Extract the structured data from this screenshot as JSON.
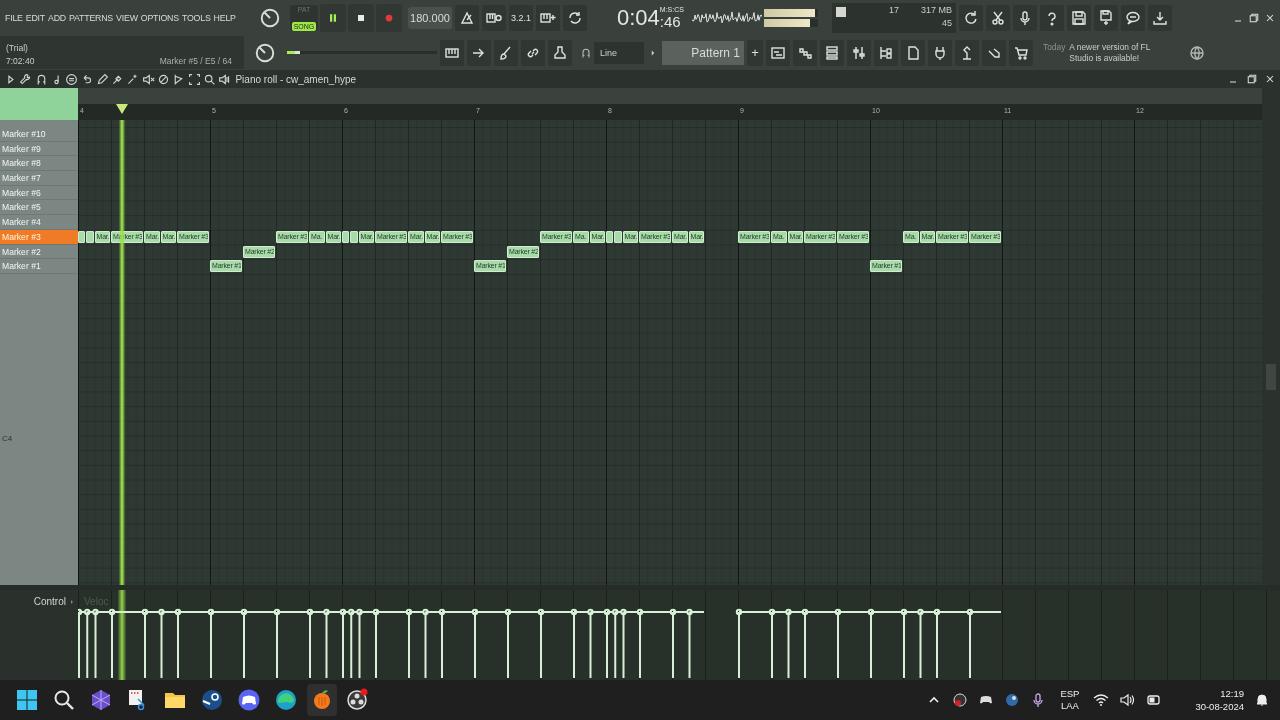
{
  "menu": [
    "FILE",
    "EDIT",
    "ADD",
    "PATTERNS",
    "VIEW",
    "OPTIONS",
    "TOOLS",
    "HELP"
  ],
  "transport": {
    "modes": [
      {
        "label": "PAT",
        "selected": false
      },
      {
        "label": "SONG",
        "selected": true
      }
    ],
    "playing": true,
    "tempo": "180.000",
    "countdown": "3.2.1",
    "time": "0:04",
    "time_unit": "M:S:CS",
    "time_cs": ":46"
  },
  "meters": [
    {
      "level": 0.95
    },
    {
      "level": 0.85
    }
  ],
  "performance": {
    "polyphony": "17",
    "memory": "317 MB",
    "cpu": "45"
  },
  "hint": {
    "mode": "(Trial)",
    "clock": "7:02:40",
    "text": "Marker #5 / E5 / 64"
  },
  "pitch": {
    "level": 0.05
  },
  "snap": "Line",
  "pattern": {
    "name": "Pattern 1",
    "add": "+"
  },
  "news": {
    "date": "Today",
    "text": "A newer version of FL Studio is available!"
  },
  "piano_roll": {
    "title": "Piano roll - cw_amen_hype",
    "bars": [
      "4",
      "5",
      "6",
      "7",
      "8",
      "9",
      "10",
      "11",
      "12"
    ],
    "bottom_key": "C4",
    "markers": [
      {
        "name": "Marker #10",
        "selected": false
      },
      {
        "name": "Marker #9",
        "selected": false
      },
      {
        "name": "Marker #8",
        "selected": false
      },
      {
        "name": "Marker #7",
        "selected": false
      },
      {
        "name": "Marker #6",
        "selected": false
      },
      {
        "name": "Marker #5",
        "selected": false
      },
      {
        "name": "Marker #4",
        "selected": false
      },
      {
        "name": "Marker #3",
        "selected": true,
        "items": [
          {
            "kind": "sixteenth"
          },
          {
            "kind": "sixteenth"
          },
          {
            "kind": "eighth",
            "label": "Mar."
          },
          {
            "kind": "quarter",
            "label": "Marker #3"
          },
          {
            "kind": "eighth",
            "label": "Mar."
          },
          {
            "kind": "eighth",
            "label": "Mar."
          },
          {
            "kind": "quarter",
            "label": "Marker #3"
          },
          {
            "kind": "pause-half"
          },
          {
            "kind": "quarter",
            "label": "Marker #3"
          },
          {
            "kind": "eighth",
            "label": "Ma."
          },
          {
            "kind": "eighth",
            "label": "Mar."
          },
          {
            "kind": "sixteenth"
          },
          {
            "kind": "sixteenth"
          },
          {
            "kind": "eighth",
            "label": "Mar."
          },
          {
            "kind": "quarter",
            "label": "Marker #3"
          },
          {
            "kind": "eighth",
            "label": "Mar."
          },
          {
            "kind": "eighth",
            "label": "Mar."
          },
          {
            "kind": "quarter",
            "label": "Marker #3"
          },
          {
            "kind": "pause-half"
          },
          {
            "kind": "quarter",
            "label": "Marker #3"
          },
          {
            "kind": "eighth",
            "label": "Ma."
          },
          {
            "kind": "eighth",
            "label": "Mar."
          },
          {
            "kind": "sixteenth"
          },
          {
            "kind": "sixteenth"
          },
          {
            "kind": "eighth",
            "label": "Mar."
          },
          {
            "kind": "quarter",
            "label": "Marker #3"
          },
          {
            "kind": "eighth",
            "label": "Mar."
          },
          {
            "kind": "eighth",
            "label": "Mar."
          },
          {
            "kind": "pause-quarter"
          },
          {
            "kind": "quarter",
            "label": "Marker #3"
          },
          {
            "kind": "eighth",
            "label": "Ma."
          },
          {
            "kind": "eighth",
            "label": "Mar."
          },
          {
            "kind": "quarter",
            "label": "Marker #3"
          },
          {
            "kind": "quarter",
            "label": "Marker #3"
          },
          {
            "kind": "pause-quarter"
          },
          {
            "kind": "eighth",
            "label": "Ma."
          },
          {
            "kind": "eighth",
            "label": "Mar."
          },
          {
            "kind": "quarter",
            "label": "Marker #3"
          },
          {
            "kind": "quarter",
            "label": "Marker #3"
          }
        ]
      },
      {
        "name": "Marker #2",
        "selected": false,
        "items": [
          {
            "kind": "pause-whole"
          },
          {
            "kind": "pause-quarter"
          },
          {
            "kind": "quarter",
            "label": "Marker #2"
          },
          {
            "kind": "pause-whole"
          },
          {
            "kind": "pause-half"
          },
          {
            "kind": "pause-quarter"
          },
          {
            "kind": "quarter",
            "label": "Marker #2"
          }
        ]
      },
      {
        "name": "Marker #1",
        "selected": false,
        "items": [
          {
            "kind": "pause-whole"
          },
          {
            "kind": "quarter",
            "label": "Marker #1"
          },
          {
            "kind": "pause-whole"
          },
          {
            "kind": "pause-half"
          },
          {
            "kind": "pause-quarter"
          },
          {
            "kind": "quarter",
            "label": "Marker #1"
          },
          {
            "kind": "pause-whole"
          },
          {
            "kind": "pause-whole"
          },
          {
            "kind": "pause-half"
          },
          {
            "kind": "pause-quarter"
          },
          {
            "kind": "quarter",
            "label": "Marker #1"
          }
        ]
      }
    ]
  },
  "control": {
    "label": "Control",
    "target": "Veloc"
  },
  "taskbar": {
    "language": "ESP",
    "layout": "LAA",
    "time": "12:19",
    "date": "30-08-2024"
  }
}
